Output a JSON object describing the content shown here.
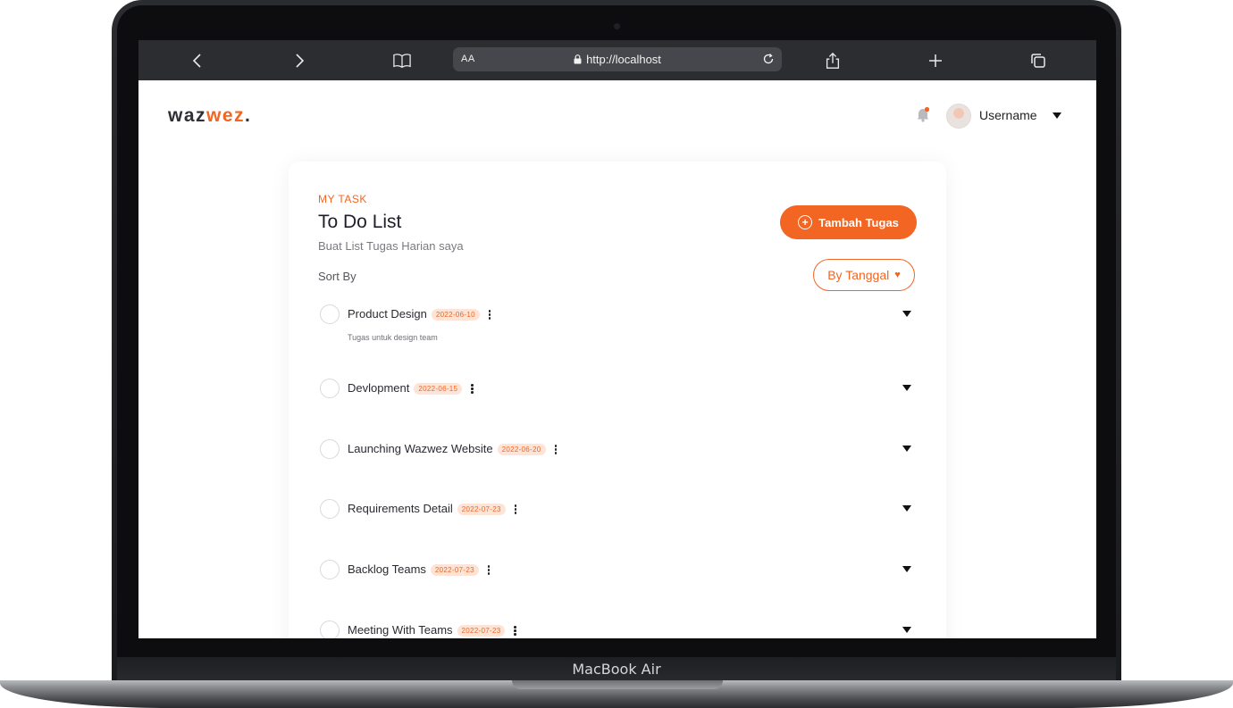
{
  "device": {
    "label": "MacBook Air"
  },
  "browser": {
    "text_size_label": "AA",
    "url": "http://localhost"
  },
  "app": {
    "logo_part1": "waz",
    "logo_part2": "wez",
    "logo_dot": ".",
    "brand_color": "#f26522",
    "user": {
      "name": "Username"
    }
  },
  "card": {
    "eyebrow": "MY TASK",
    "title": "To Do List",
    "subtitle": "Buat List Tugas Harian saya",
    "add_button": "Tambah Tugas",
    "sort_label": "Sort By",
    "sort_button": "By Tanggal"
  },
  "tasks": [
    {
      "name": "Product Design",
      "date": "2022-06-10",
      "description": "Tugas untuk design team"
    },
    {
      "name": "Devlopment",
      "date": "2022-06-15",
      "description": ""
    },
    {
      "name": "Launching Wazwez Website",
      "date": "2022-06-20",
      "description": ""
    },
    {
      "name": "Requirements Detail",
      "date": "2022-07-23",
      "description": ""
    },
    {
      "name": "Backlog Teams",
      "date": "2022-07-23",
      "description": ""
    },
    {
      "name": "Meeting With Teams",
      "date": "2022-07-23",
      "description": ""
    }
  ]
}
